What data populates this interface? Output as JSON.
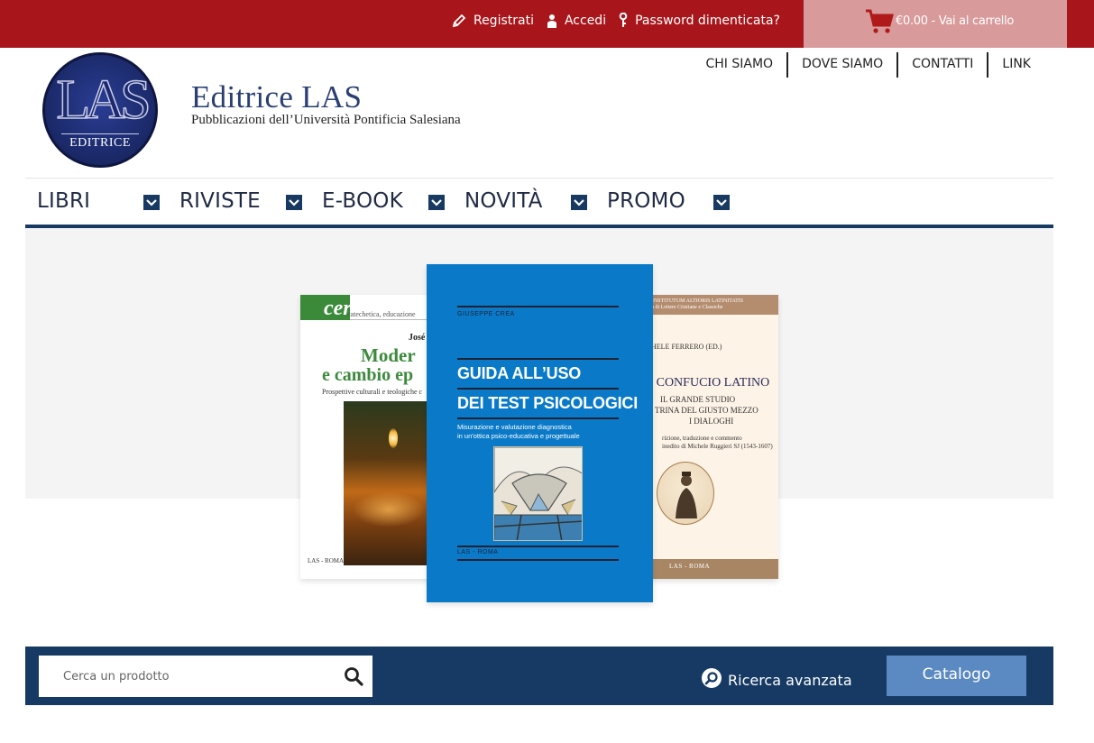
{
  "topbar": {
    "register": "Registrati",
    "login": "Accedi",
    "forgot_password": "Password dimenticata?",
    "cart": "€0.00 - Vai al carrello"
  },
  "header": {
    "logo_text": "LAS",
    "logo_sub": "EDITRICE",
    "title": "Editrice LAS",
    "subtitle": "Pubblicazioni dell’Università Pontificia Salesiana"
  },
  "util_nav": [
    "CHI SIAMO",
    "DOVE SIAMO",
    "CONTATTI",
    "LINK"
  ],
  "main_nav": [
    "LIBRI",
    "RIVISTE",
    "E-BOOK",
    "NOVITÀ",
    "PROMO"
  ],
  "books": {
    "left": {
      "series_mark": "cer",
      "series": "catechetica, educazione",
      "author": "José",
      "title_line1": "Moder",
      "title_line2": "e cambio ep",
      "subtitle": "Prospettive culturali e teologiche c",
      "publisher": "LAS - ROMA"
    },
    "center": {
      "author": "GIUSEPPE CREA",
      "title_line1": "GUIDA ALL’USO",
      "title_line2": "DEI TEST PSICOLOGICI",
      "subtitle_line1": "Misurazione e valutazione diagnostica",
      "subtitle_line2": "in un'ottica psico-educativa e progettuale",
      "publisher": "LAS - ROMA"
    },
    "right": {
      "series_line1": "M INSTITUTUM ALTIORIS LATINITATIS",
      "series_line2": "oltà di Lettere Cristiane e Classiche",
      "author": "ICHELE FERRERO (ED.)",
      "title": "O CONFUCIO LATINO",
      "sub_line1": "IL GRANDE STUDIO",
      "sub_line2": "TRINA DEL GIUSTO MEZZO",
      "sub_line3": "I DIALOGHI",
      "note_line1": "rizione, traduzione e commento",
      "note_line2": "inedito di Michele Ruggieri SJ (1543-1607)",
      "publisher": "LAS - ROMA"
    }
  },
  "search": {
    "placeholder": "Cerca un prodotto",
    "advanced": "Ricerca avanzata",
    "catalog": "Catalogo"
  }
}
